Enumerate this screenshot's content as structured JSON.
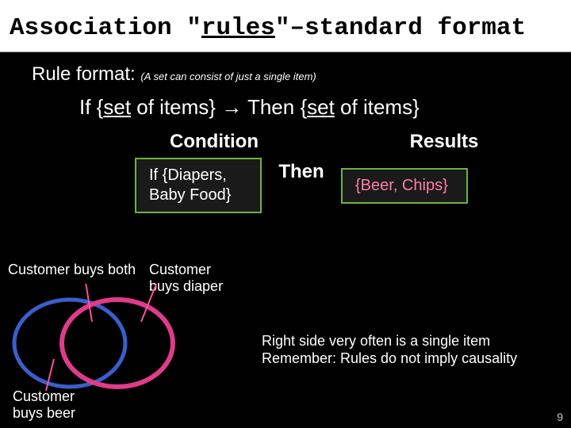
{
  "title": {
    "pre": "Association \"",
    "underlined": "rules",
    "post": "\"–standard format"
  },
  "rule_format": {
    "label": "Rule format:",
    "note": "(A set can consist of just a single item)"
  },
  "rule_line": {
    "if": "If {",
    "set1_ul": "set",
    "mid1": " of items} ",
    "arrow": "→",
    "then": " Then {",
    "set2_ul": "set",
    "mid2": " of items}"
  },
  "headers": {
    "condition": "Condition",
    "results": "Results"
  },
  "example": {
    "condition_l1": "If {Diapers,",
    "condition_l2": "Baby Food}",
    "then": "Then",
    "results": "{Beer, Chips}"
  },
  "venn": {
    "label_both": "Customer buys both",
    "label_diaper": "Customer\nbuys diaper",
    "label_beer": "Customer\nbuys beer",
    "colors": {
      "left_stroke": "#3a5ecc",
      "right_stroke": "#e03b8b",
      "pointer": "#ff4fa3"
    }
  },
  "notes": {
    "line1": "Right side very often is a single item",
    "line2": "Remember: Rules do not imply causality"
  },
  "page": "9"
}
